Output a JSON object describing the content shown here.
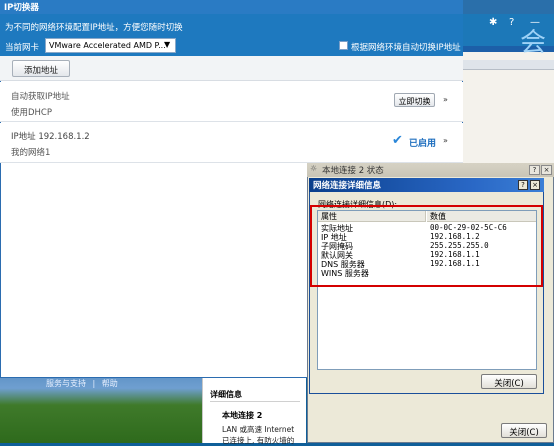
{
  "app": {
    "title": "IP切换器",
    "subtitle": "为不同的网络环境配置IP地址，方便您随时切换",
    "nic_label": "当前网卡",
    "nic_value": "VMware Accelerated AMD P...",
    "auto_switch_label": "根据网络环境自动切换IP地址",
    "add_address_label": "添加地址",
    "profiles": [
      {
        "title": "自动获取IP地址",
        "subtitle": "使用DHCP",
        "action_label": "立即切换",
        "expand_glyph": "»"
      },
      {
        "title": "IP地址  192.168.1.2",
        "subtitle": "我的网络1",
        "status_label": "已启用",
        "status_icon": "✔",
        "expand_glyph": "»"
      }
    ]
  },
  "status_window": {
    "title": "本地连接 2 状态",
    "help_glyph": "?",
    "close_glyph": "×",
    "close_label": "关闭(C)"
  },
  "details_dialog": {
    "title": "网络连接详细信息",
    "help_glyph": "?",
    "close_glyph": "×",
    "caption": "网络连接详细信息(D):",
    "columns": [
      "属性",
      "数值"
    ],
    "rows": [
      {
        "property": "实际地址",
        "value": "00-0C-29-02-5C-C6"
      },
      {
        "property": "IP 地址",
        "value": "192.168.1.2"
      },
      {
        "property": "子网掩码",
        "value": "255.255.255.0"
      },
      {
        "property": "默认网关",
        "value": "192.168.1.1"
      },
      {
        "property": "DNS 服务器",
        "value": "192.168.1.1"
      },
      {
        "property": "WINS 服务器",
        "value": ""
      }
    ],
    "close_label": "关闭(C)"
  },
  "background": {
    "top_bar_glyphs": {
      "gear": "✱",
      "help": "?",
      "minimize": "—"
    },
    "big_text": "会",
    "support_links": [
      "服务与支持",
      "|",
      "帮助"
    ],
    "bottom_panel": {
      "header": "详细信息",
      "title": "本地连接 2",
      "line1": "LAN 或高速 Internet",
      "line2": "已连接上, 有防火墙的"
    }
  },
  "colors": {
    "accent_blue": "#1e79bf",
    "highlight_red": "#d40000",
    "enabled_blue": "#1f6fbf"
  }
}
